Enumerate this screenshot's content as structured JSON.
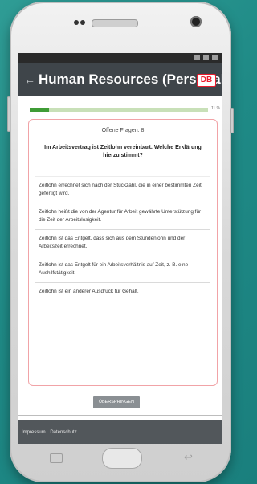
{
  "app": {
    "title": "Human Resources (Personal)",
    "logo_text": "DB",
    "back_glyph": "←"
  },
  "progress": {
    "percent_label": "11 %",
    "fraction": 0.11
  },
  "quiz": {
    "open_questions": "Offene Fragen: 8",
    "question": "Im Arbeitsvertrag ist Zeitlohn vereinbart. Welche Erklärung hierzu stimmt?",
    "answers": [
      "Zeitlohn errechnet sich nach der Stückzahl, die in einer bestimmten Zeit gefertigt wird.",
      "Zeitlohn heißt die von der Agentur für Arbeit gewährte Unterstützung für die Zeit der Arbeitslosigkeit.",
      "Zeitlohn ist das Entgelt, dass sich aus dem Stundenlohn und der Arbeitszeit errechnet.",
      "Zeitlohn ist das Entgelt für ein Arbeitsverhältnis auf Zeit, z. B. eine Aushilfstätigkeit.",
      "Zeitlohn ist ein anderer Ausdruck für Gehalt."
    ],
    "skip_label": "ÜBERSPRINGEN"
  },
  "footer": {
    "impressum": "Impressum",
    "datenschutz": "Datenschutz"
  },
  "colors": {
    "appbar": "#3f454a",
    "accent_red": "#ec1b2d",
    "progress_green": "#3f9c36",
    "background_teal": "#1f8a86"
  },
  "icons": [
    "back-arrow-icon",
    "db-logo",
    "home-icon",
    "recent-apps-icon",
    "system-back-icon"
  ]
}
